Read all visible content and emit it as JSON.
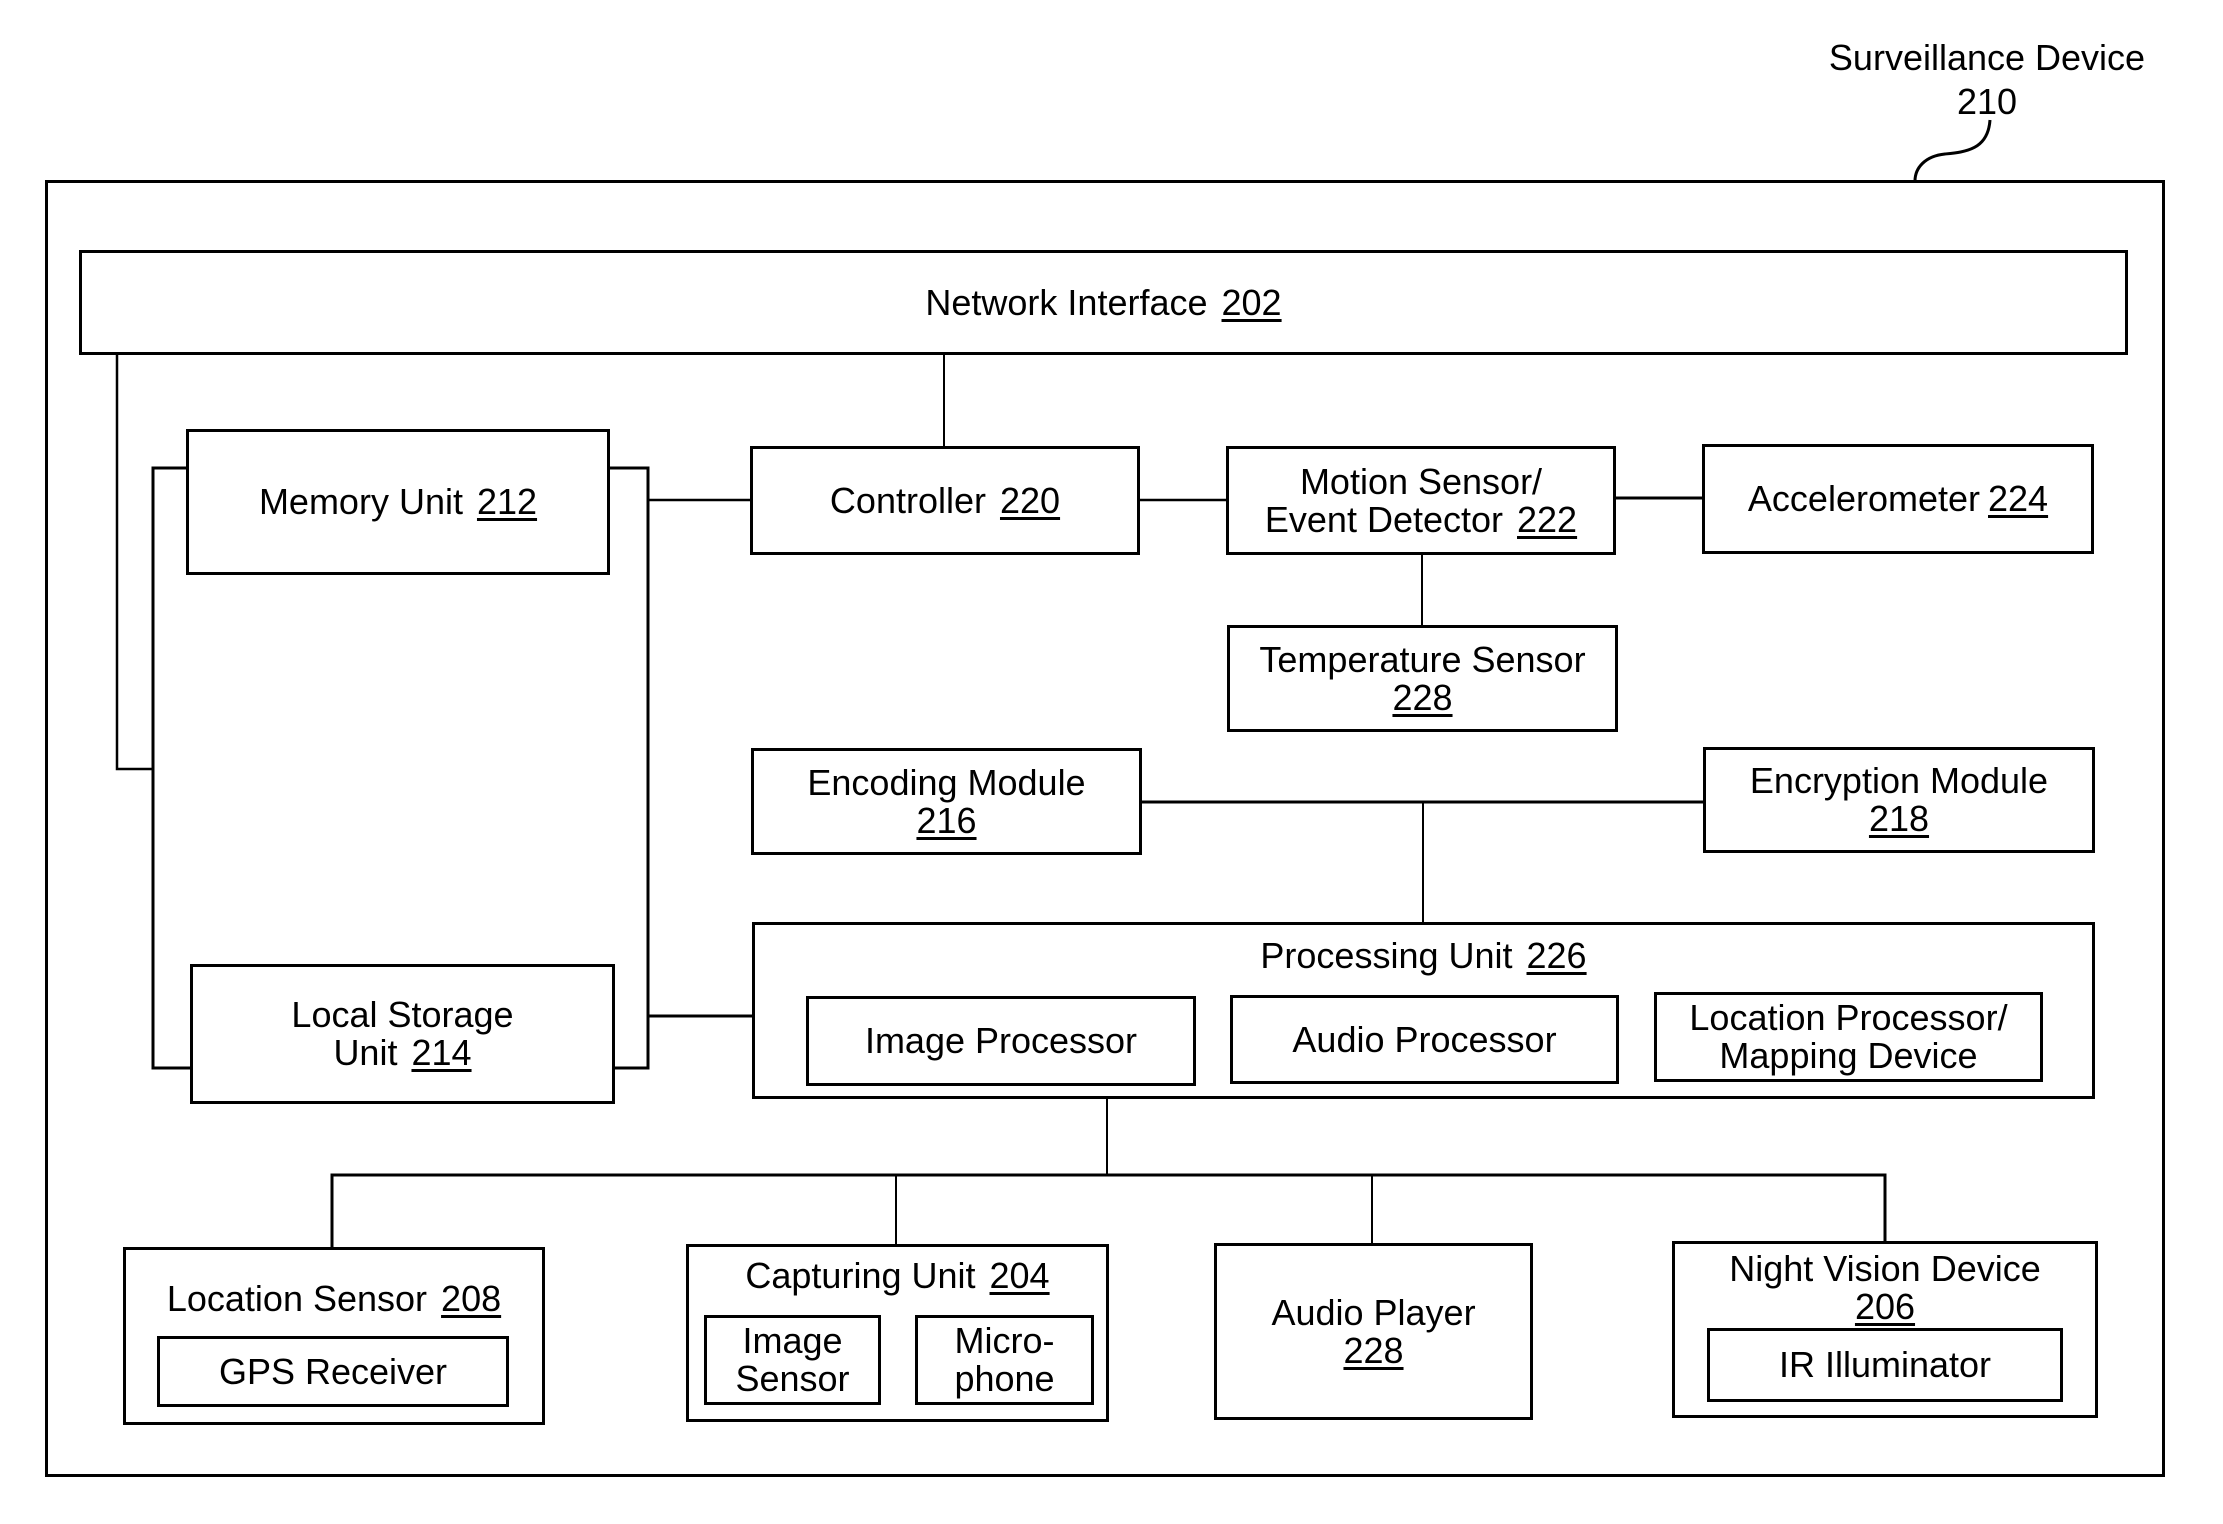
{
  "figure": {
    "title": "Surveillance Device",
    "ref": "210"
  },
  "components": {
    "network_interface": {
      "label": "Network Interface",
      "ref": "202"
    },
    "memory_unit": {
      "label": "Memory Unit",
      "ref": "212"
    },
    "local_storage": {
      "label_line1": "Local Storage",
      "label_line2": "Unit",
      "ref": "214"
    },
    "controller": {
      "label": "Controller",
      "ref": "220"
    },
    "motion_sensor": {
      "label_line1": "Motion Sensor/",
      "label_line2": "Event Detector",
      "ref": "222"
    },
    "accelerometer": {
      "label": "Accelerometer",
      "ref": "224"
    },
    "temperature_sensor": {
      "label": "Temperature Sensor",
      "ref": "228"
    },
    "encoding_module": {
      "label": "Encoding Module",
      "ref": "216"
    },
    "encryption_module": {
      "label": "Encryption Module",
      "ref": "218"
    },
    "processing_unit": {
      "label": "Processing Unit",
      "ref": "226",
      "subunits": [
        {
          "label": "Image Processor"
        },
        {
          "label": "Audio Processor"
        },
        {
          "label_line1": "Location Processor/",
          "label_line2": "Mapping Device"
        }
      ]
    },
    "location_sensor": {
      "label": "Location Sensor",
      "ref": "208",
      "sub": "GPS Receiver"
    },
    "capturing_unit": {
      "label": "Capturing Unit",
      "ref": "204",
      "subunits": [
        {
          "label_line1": "Image",
          "label_line2": "Sensor"
        },
        {
          "label_line1": "Micro-",
          "label_line2": "phone"
        }
      ]
    },
    "audio_player": {
      "label": "Audio Player",
      "ref": "228"
    },
    "night_vision": {
      "label": "Night Vision Device",
      "ref": "206",
      "sub": "IR Illuminator"
    }
  }
}
